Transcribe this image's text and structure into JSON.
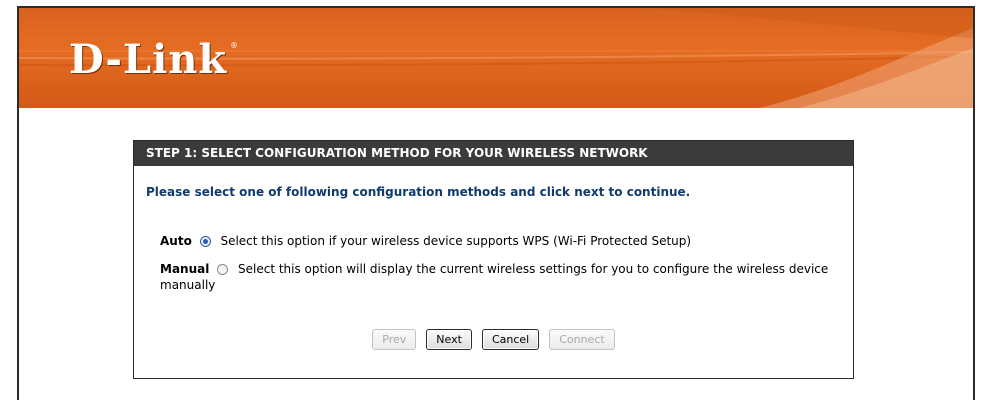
{
  "header": {
    "logo_text": "D-Link",
    "logo_mark": "®",
    "colors": {
      "banner": "#e06a22",
      "panel_title_bg": "#3b3b3b",
      "instruction": "#0f3b70"
    }
  },
  "panel": {
    "title": "STEP 1: SELECT CONFIGURATION METHOD FOR YOUR WIRELESS NETWORK",
    "instruction": "Please select one of following configuration methods and click next to continue.",
    "options": [
      {
        "label": "Auto",
        "selected": true,
        "description": "Select this option if your wireless device supports WPS (Wi-Fi Protected Setup)"
      },
      {
        "label": "Manual",
        "selected": false,
        "description": "Select this option will display the current wireless settings for you to configure the wireless device manually"
      }
    ],
    "buttons": {
      "prev": "Prev",
      "next": "Next",
      "cancel": "Cancel",
      "connect": "Connect"
    }
  }
}
